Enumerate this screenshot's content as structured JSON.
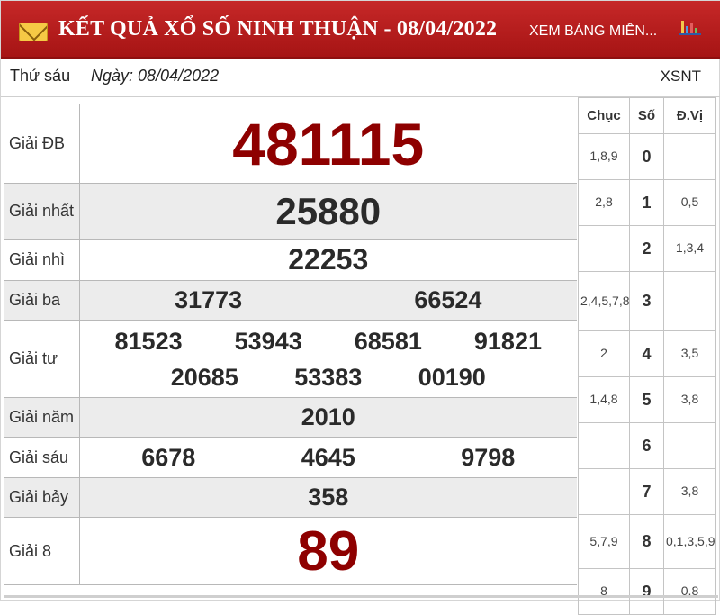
{
  "header": {
    "title": "KẾT QUẢ XỔ SỐ NINH THUẬN - 08/04/2022",
    "link": "XEM BẢNG MIỀN...",
    "mail_icon": "mail-icon",
    "chart_icon": "bar-chart-icon",
    "bg_color": "#b71c1c"
  },
  "info": {
    "day": "Thứ sáu",
    "date": "Ngày: 08/04/2022",
    "code": "XSNT"
  },
  "prizes": [
    {
      "label": "Giải ĐB",
      "numbers": [
        "481115"
      ]
    },
    {
      "label": "Giải nhất",
      "numbers": [
        "25880"
      ]
    },
    {
      "label": "Giải nhì",
      "numbers": [
        "22253"
      ]
    },
    {
      "label": "Giải ba",
      "numbers": [
        "31773",
        "66524"
      ]
    },
    {
      "label": "Giải tư",
      "numbers": [
        "81523",
        "53943",
        "68581",
        "91821",
        "20685",
        "53383",
        "00190"
      ]
    },
    {
      "label": "Giải năm",
      "numbers": [
        "2010"
      ]
    },
    {
      "label": "Giải sáu",
      "numbers": [
        "6678",
        "4645",
        "9798"
      ]
    },
    {
      "label": "Giải bảy",
      "numbers": [
        "358"
      ]
    },
    {
      "label": "Giải 8",
      "numbers": [
        "89"
      ]
    }
  ],
  "loto": {
    "headers": [
      "Chục",
      "Số",
      "Đ.Vị"
    ],
    "rows": [
      {
        "chuc": "1,8,9",
        "so": "0",
        "dvi": ""
      },
      {
        "chuc": "2,8",
        "so": "1",
        "dvi": "0,5"
      },
      {
        "chuc": "",
        "so": "2",
        "dvi": "1,3,4"
      },
      {
        "chuc": "2,4,5,7,8",
        "so": "3",
        "dvi": ""
      },
      {
        "chuc": "2",
        "so": "4",
        "dvi": "3,5"
      },
      {
        "chuc": "1,4,8",
        "so": "5",
        "dvi": "3,8"
      },
      {
        "chuc": "",
        "so": "6",
        "dvi": ""
      },
      {
        "chuc": "",
        "so": "7",
        "dvi": "3,8"
      },
      {
        "chuc": "5,7,9",
        "so": "8",
        "dvi": "0,1,3,5,9"
      },
      {
        "chuc": "8",
        "so": "9",
        "dvi": "0,8"
      }
    ]
  },
  "colors": {
    "special": "#8e0000",
    "number": "#2a2a2a",
    "shade": "#ececec"
  }
}
